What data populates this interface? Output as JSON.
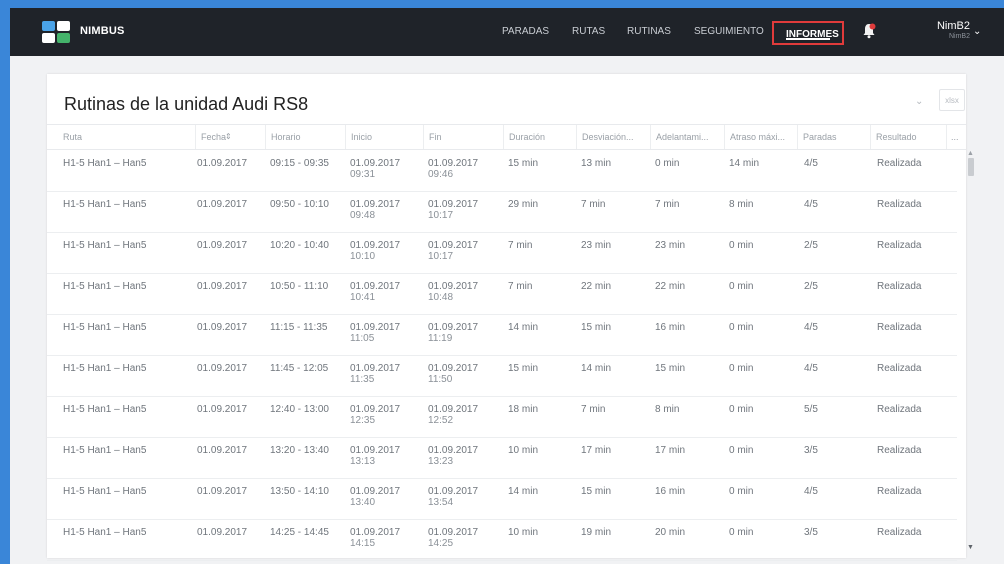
{
  "app": {
    "brand": "NIMBUS"
  },
  "nav": {
    "items": [
      {
        "label": "PARADAS"
      },
      {
        "label": "RUTAS"
      },
      {
        "label": "RUTINAS"
      },
      {
        "label": "SEGUIMIENTO"
      },
      {
        "label": "INFORMES",
        "active": true
      }
    ]
  },
  "user": {
    "name": "NimB2",
    "sub": "NimB2"
  },
  "panel": {
    "title": "Rutinas de la unidad Audi RS8",
    "export_label": "xlsx"
  },
  "table": {
    "columns": [
      "Ruta",
      "Fecha",
      "Horario",
      "Inicio",
      "Fin",
      "Duración",
      "Desviación...",
      "Adelantami...",
      "Atraso máxi...",
      "Paradas",
      "Resultado",
      "..."
    ],
    "rows": [
      {
        "ruta": "H1-5 Han1 – Han5",
        "fecha": "01.09.2017",
        "horario": "09:15 - 09:35",
        "inicio_d": "01.09.2017",
        "inicio_t": "09:31",
        "fin_d": "01.09.2017",
        "fin_t": "09:46",
        "duracion": "15 min",
        "desviacion": "13 min",
        "adelanto": "0 min",
        "atraso": "14 min",
        "paradas": "4/5",
        "resultado": "Realizada"
      },
      {
        "ruta": "H1-5 Han1 – Han5",
        "fecha": "01.09.2017",
        "horario": "09:50 - 10:10",
        "inicio_d": "01.09.2017",
        "inicio_t": "09:48",
        "fin_d": "01.09.2017",
        "fin_t": "10:17",
        "duracion": "29 min",
        "desviacion": "7 min",
        "adelanto": "7 min",
        "atraso": "8 min",
        "paradas": "4/5",
        "resultado": "Realizada"
      },
      {
        "ruta": "H1-5 Han1 – Han5",
        "fecha": "01.09.2017",
        "horario": "10:20 - 10:40",
        "inicio_d": "01.09.2017",
        "inicio_t": "10:10",
        "fin_d": "01.09.2017",
        "fin_t": "10:17",
        "duracion": "7 min",
        "desviacion": "23 min",
        "adelanto": "23 min",
        "atraso": "0 min",
        "paradas": "2/5",
        "resultado": "Realizada"
      },
      {
        "ruta": "H1-5 Han1 – Han5",
        "fecha": "01.09.2017",
        "horario": "10:50 - 11:10",
        "inicio_d": "01.09.2017",
        "inicio_t": "10:41",
        "fin_d": "01.09.2017",
        "fin_t": "10:48",
        "duracion": "7 min",
        "desviacion": "22 min",
        "adelanto": "22 min",
        "atraso": "0 min",
        "paradas": "2/5",
        "resultado": "Realizada"
      },
      {
        "ruta": "H1-5 Han1 – Han5",
        "fecha": "01.09.2017",
        "horario": "11:15 - 11:35",
        "inicio_d": "01.09.2017",
        "inicio_t": "11:05",
        "fin_d": "01.09.2017",
        "fin_t": "11:19",
        "duracion": "14 min",
        "desviacion": "15 min",
        "adelanto": "16 min",
        "atraso": "0 min",
        "paradas": "4/5",
        "resultado": "Realizada"
      },
      {
        "ruta": "H1-5 Han1 – Han5",
        "fecha": "01.09.2017",
        "horario": "11:45 - 12:05",
        "inicio_d": "01.09.2017",
        "inicio_t": "11:35",
        "fin_d": "01.09.2017",
        "fin_t": "11:50",
        "duracion": "15 min",
        "desviacion": "14 min",
        "adelanto": "15 min",
        "atraso": "0 min",
        "paradas": "4/5",
        "resultado": "Realizada"
      },
      {
        "ruta": "H1-5 Han1 – Han5",
        "fecha": "01.09.2017",
        "horario": "12:40 - 13:00",
        "inicio_d": "01.09.2017",
        "inicio_t": "12:35",
        "fin_d": "01.09.2017",
        "fin_t": "12:52",
        "duracion": "18 min",
        "desviacion": "7 min",
        "adelanto": "8 min",
        "atraso": "0 min",
        "paradas": "5/5",
        "resultado": "Realizada"
      },
      {
        "ruta": "H1-5 Han1 – Han5",
        "fecha": "01.09.2017",
        "horario": "13:20 - 13:40",
        "inicio_d": "01.09.2017",
        "inicio_t": "13:13",
        "fin_d": "01.09.2017",
        "fin_t": "13:23",
        "duracion": "10 min",
        "desviacion": "17 min",
        "adelanto": "17 min",
        "atraso": "0 min",
        "paradas": "3/5",
        "resultado": "Realizada"
      },
      {
        "ruta": "H1-5 Han1 – Han5",
        "fecha": "01.09.2017",
        "horario": "13:50 - 14:10",
        "inicio_d": "01.09.2017",
        "inicio_t": "13:40",
        "fin_d": "01.09.2017",
        "fin_t": "13:54",
        "duracion": "14 min",
        "desviacion": "15 min",
        "adelanto": "16 min",
        "atraso": "0 min",
        "paradas": "4/5",
        "resultado": "Realizada"
      },
      {
        "ruta": "H1-5 Han1 – Han5",
        "fecha": "01.09.2017",
        "horario": "14:25 - 14:45",
        "inicio_d": "01.09.2017",
        "inicio_t": "14:15",
        "fin_d": "01.09.2017",
        "fin_t": "14:25",
        "duracion": "10 min",
        "desviacion": "19 min",
        "adelanto": "20 min",
        "atraso": "0 min",
        "paradas": "3/5",
        "resultado": "Realizada"
      }
    ]
  },
  "colors": {
    "accent_border": "#e03b3b",
    "topbar": "#1f2329",
    "page_bg": "#3a86d8"
  },
  "icons": {
    "logo": "nimbus-logo",
    "bell": "notification-bell-icon",
    "user_menu": "chevron-down-icon"
  }
}
